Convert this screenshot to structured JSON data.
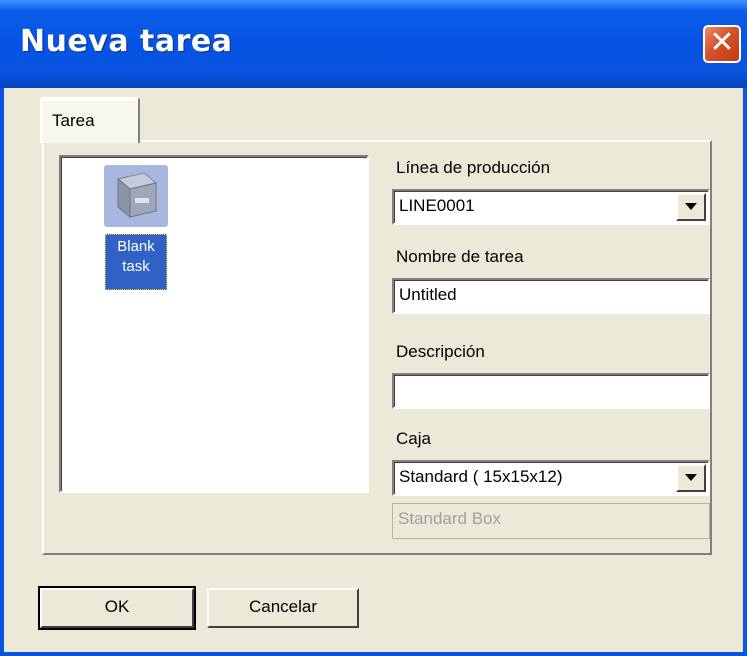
{
  "window": {
    "title": "Nueva tarea",
    "colors": {
      "titlebar": "#0a55e0",
      "close": "#d6512b",
      "face": "#ece9d8",
      "selection": "#3161c5"
    }
  },
  "tabs": [
    {
      "label": "Tarea"
    }
  ],
  "templates": [
    {
      "label": "Blank task",
      "icon": "box-icon",
      "selected": true
    }
  ],
  "form": {
    "line_label": "Línea de producción",
    "line_value": "LINE0001",
    "name_label": "Nombre de tarea",
    "name_value": "Untitled",
    "desc_label": "Descripción",
    "desc_value": "",
    "box_label": "Caja",
    "box_value": "Standard ( 15x15x12)",
    "box_name_value": "Standard Box"
  },
  "buttons": {
    "ok": "OK",
    "cancel": "Cancelar"
  }
}
